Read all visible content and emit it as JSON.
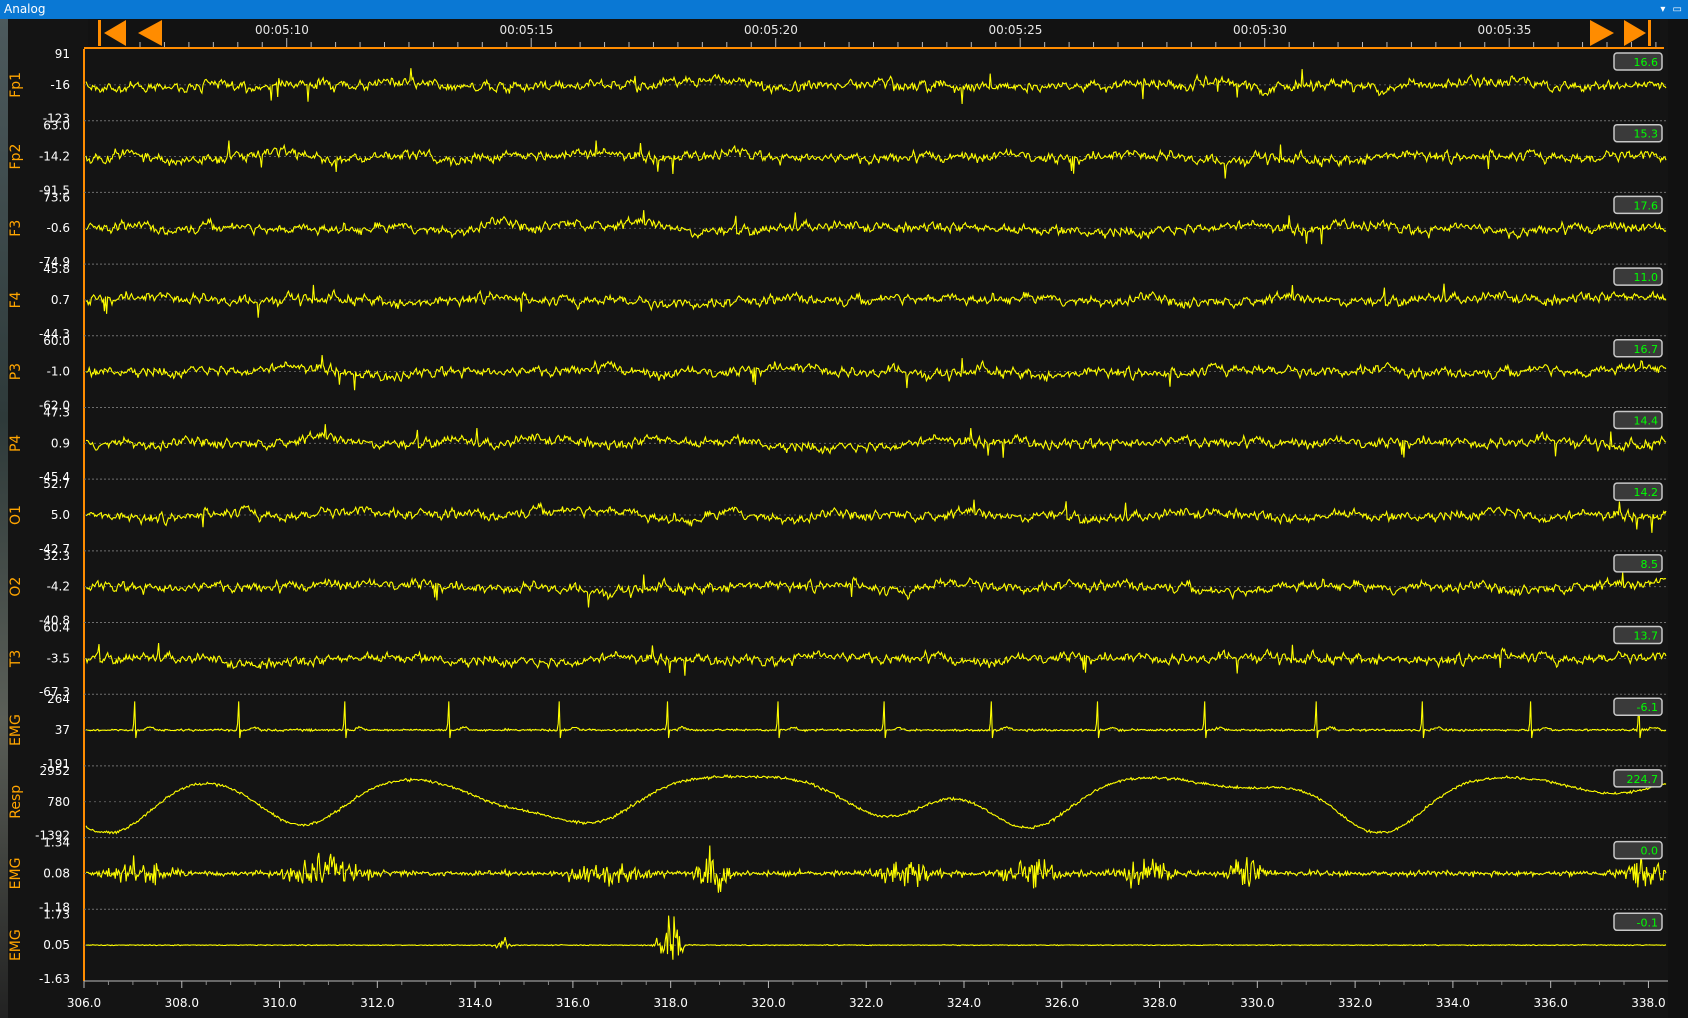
{
  "window": {
    "title": "Analog",
    "controls": "▾ ▭"
  },
  "toolbar": {
    "first_icon": "skip-to-start-icon",
    "prev_icon": "step-back-icon",
    "next_icon": "step-forward-icon",
    "last_icon": "skip-to-end-icon"
  },
  "timeline": {
    "labels": [
      "00:05:10",
      "00:05:15",
      "00:05:20",
      "00:05:25",
      "00:05:30",
      "00:05:35"
    ]
  },
  "colors": {
    "trace": "#ffff00",
    "accent": "#ff8c00",
    "channel_label": "#ffa500",
    "value_box_text": "#00ff00",
    "background": "#141414",
    "grid": "#6e6e6e"
  },
  "chart_data": {
    "type": "line",
    "title": "",
    "xlabel": "",
    "ylabel": "",
    "x_ticks": [
      "306.0",
      "308.0",
      "310.0",
      "312.0",
      "314.0",
      "316.0",
      "318.0",
      "320.0",
      "322.0",
      "324.0",
      "326.0",
      "328.0",
      "330.0",
      "332.0",
      "334.0",
      "336.0",
      "338.0"
    ],
    "xlim": [
      306,
      338.4
    ],
    "grid": true,
    "channels": [
      {
        "name": "Fp1",
        "top": "91",
        "mid": "-16",
        "bottom": "-123",
        "value": "16.6",
        "kind": "eeg"
      },
      {
        "name": "Fp2",
        "top": "63.0",
        "mid": "-14.2",
        "bottom": "-91.5",
        "value": "15.3",
        "kind": "eeg"
      },
      {
        "name": "F3",
        "top": "73.6",
        "mid": "-0.6",
        "bottom": "-74.9",
        "value": "17.6",
        "kind": "eeg"
      },
      {
        "name": "F4",
        "top": "45.8",
        "mid": "0.7",
        "bottom": "-44.3",
        "value": "11.0",
        "kind": "eeg"
      },
      {
        "name": "P3",
        "top": "60.0",
        "mid": "-1.0",
        "bottom": "-62.0",
        "value": "16.7",
        "kind": "eeg"
      },
      {
        "name": "P4",
        "top": "47.3",
        "mid": "0.9",
        "bottom": "-45.4",
        "value": "14.4",
        "kind": "eeg"
      },
      {
        "name": "O1",
        "top": "52.7",
        "mid": "5.0",
        "bottom": "-42.7",
        "value": "14.2",
        "kind": "eeg"
      },
      {
        "name": "O2",
        "top": "32.3",
        "mid": "-4.2",
        "bottom": "-40.8",
        "value": "8.5",
        "kind": "eeg"
      },
      {
        "name": "T3",
        "top": "60.4",
        "mid": "-3.5",
        "bottom": "-67.3",
        "value": "13.7",
        "kind": "eeg"
      },
      {
        "name": "EMG",
        "top": "264",
        "mid": "37",
        "bottom": "-191",
        "value": "-6.1",
        "kind": "ecg"
      },
      {
        "name": "Resp",
        "top": "2952",
        "mid": "780",
        "bottom": "-1392",
        "value": "224.7",
        "kind": "resp"
      },
      {
        "name": "EMG",
        "top": "1.34",
        "mid": "0.08",
        "bottom": "-1.18",
        "value": "0.0",
        "kind": "emg"
      },
      {
        "name": "EMG",
        "top": "1.73",
        "mid": "0.05",
        "bottom": "-1.63",
        "value": "-0.1",
        "kind": "emg2"
      }
    ]
  }
}
